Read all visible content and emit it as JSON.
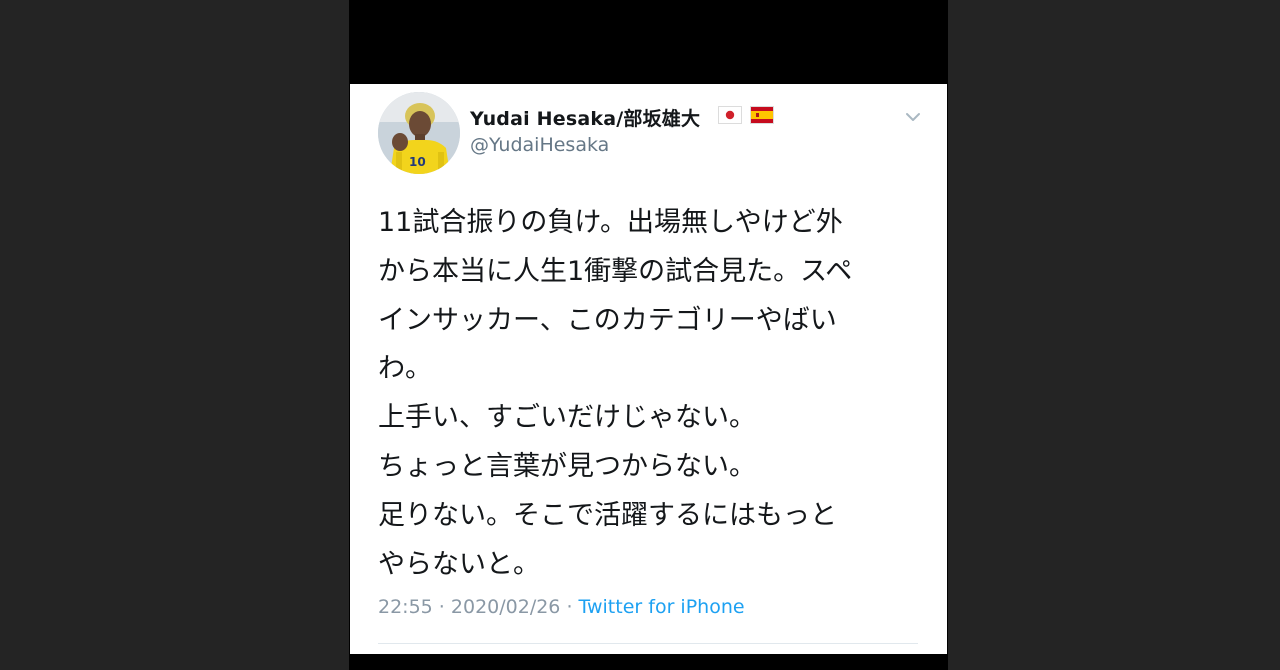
{
  "tweet": {
    "author": {
      "display_name": "Yudai Hesaka/部坂雄大",
      "handle": "@YudaiHesaka",
      "flags": [
        "japan-flag-icon",
        "spain-flag-icon"
      ],
      "avatar_jersey_number": "10"
    },
    "menu_icon": "chevron-down-icon",
    "text_lines": [
      "11試合振りの負け。出場無しやけど外",
      "から本当に人生1衝撃の試合見た。スペ",
      "インサッカー、このカテゴリーやばい",
      "わ。",
      "上手い、すごいだけじゃない。",
      "ちょっと言葉が見つからない。",
      "足りない。そこで活躍するにはもっと",
      "やらないと。"
    ],
    "time": "22:55",
    "separator": " · ",
    "date": "2020/02/26",
    "source": "Twitter for iPhone"
  },
  "colors": {
    "background": "#242424",
    "card": "#ffffff",
    "name": "#14171a",
    "handle": "#657786",
    "meta": "#8a98a5",
    "link": "#1da1f2"
  }
}
